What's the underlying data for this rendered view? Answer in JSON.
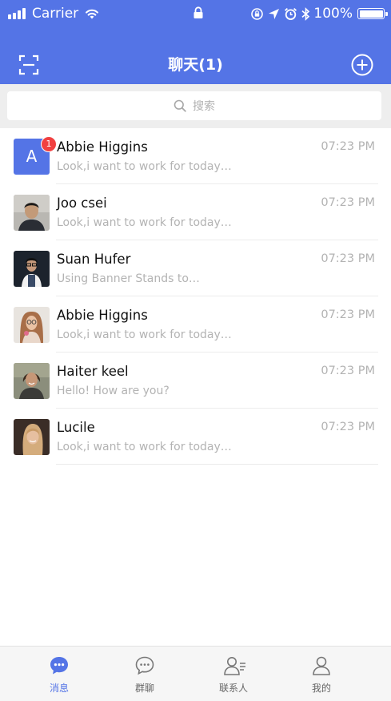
{
  "status_bar": {
    "carrier": "Carrier",
    "battery": "100%",
    "battery_level": 1.0
  },
  "nav": {
    "title": "聊天(1)",
    "left_icon": "scan-icon",
    "right_icon": "add-circle-icon"
  },
  "search": {
    "placeholder": "搜索"
  },
  "conversations": [
    {
      "name": "Abbie Higgins",
      "preview": "Look,i want to work for today…",
      "time": "07:23 PM",
      "avatar_letter": "A",
      "unread": "1"
    },
    {
      "name": "Joo csei",
      "preview": "Look,i want to work for today…",
      "time": "07:23 PM"
    },
    {
      "name": "Suan Hufer",
      "preview": "Using Banner Stands to…",
      "time": "07:23 PM"
    },
    {
      "name": "Abbie Higgins",
      "preview": "Look,i want to work for today…",
      "time": "07:23 PM"
    },
    {
      "name": "Haiter keel",
      "preview": "Hello! How are you?",
      "time": "07:23 PM"
    },
    {
      "name": "Lucile",
      "preview": "Look,i want to work for today…",
      "time": "07:23 PM"
    }
  ],
  "tabs": [
    {
      "label": "消息",
      "icon": "chat-bubble-icon",
      "active": true
    },
    {
      "label": "群聊",
      "icon": "group-chat-icon",
      "active": false
    },
    {
      "label": "联系人",
      "icon": "contacts-icon",
      "active": false
    },
    {
      "label": "我的",
      "icon": "profile-icon",
      "active": false
    }
  ],
  "colors": {
    "primary": "#5474e6",
    "badge": "#f14141",
    "secondary_text": "#b3b3b3"
  }
}
